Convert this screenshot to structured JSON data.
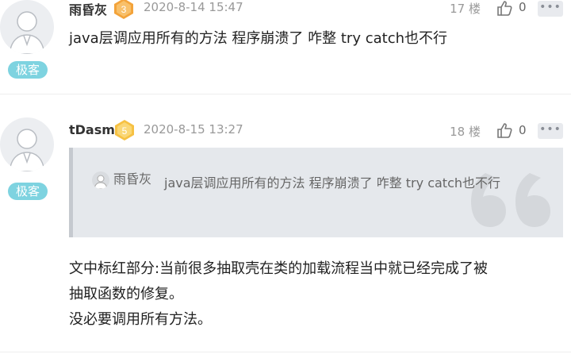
{
  "comments": [
    {
      "username": "雨昏灰",
      "level": "3",
      "badge": "极客",
      "date": "2020-8-14 15:47",
      "floor": "17 楼",
      "likes": "0",
      "more": "•••",
      "content": "java层调应用所有的方法  程序崩溃了  咋整  try catch也不行"
    },
    {
      "username": "tDasm",
      "level": "5",
      "badge": "极客",
      "date": "2020-8-15 13:27",
      "floor": "18 楼",
      "likes": "0",
      "more": "•••",
      "quote": {
        "username": "雨昏灰",
        "text": "java层调应用所有的方法 程序崩溃了 咋整 try catch也不行"
      },
      "content_lines": [
        "文中标红部分:当前很多抽取壳在类的加载流程当中就已经完成了被",
        "抽取函数的修复。",
        "没必要调用所有方法。"
      ]
    }
  ],
  "colors": {
    "badge_bg": "#7ed3e0",
    "medal_level3": "#f3a33a",
    "medal_level5": "#f6c143",
    "quote_bg": "#e5e8ec"
  },
  "icons": [
    "avatar",
    "medal-icon",
    "thumbs-up-icon",
    "more-icon",
    "quote-mark-icon"
  ]
}
